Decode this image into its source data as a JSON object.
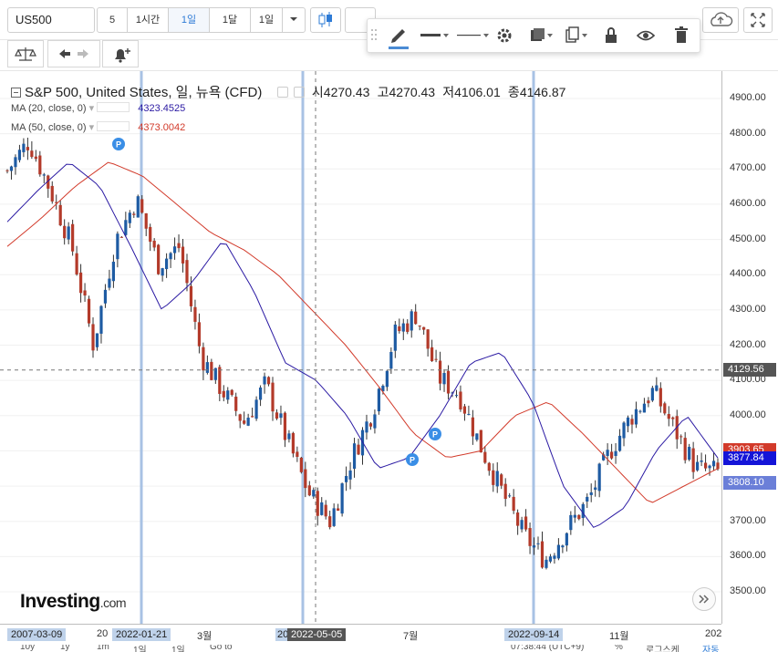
{
  "toolbar": {
    "symbol": "US500",
    "timeframes": [
      "5",
      "1시간",
      "1일",
      "1달",
      "1일"
    ],
    "active_timeframe": "1일"
  },
  "legend": {
    "title": "S&P 500, United States, 일, 뉴욕 (CFD)",
    "open_label": "시",
    "open": "4270.43",
    "high_label": "고",
    "high": "4270.43",
    "low_label": "저",
    "low": "4106.01",
    "close_label": "종",
    "close": "4146.87",
    "ma1_label": "MA (20, close, 0)",
    "ma1_value": "4323.4525",
    "ma1_color": "#2b1aa3",
    "ma2_label": "MA (50, close, 0)",
    "ma2_value": "4373.0042",
    "ma2_color": "#d23a2a"
  },
  "price_axis": {
    "ticks": [
      "4900.00",
      "4800.00",
      "4700.00",
      "4600.00",
      "4500.00",
      "4400.00",
      "4300.00",
      "4200.00",
      "4100.00",
      "4000.00",
      "3900.00",
      "3800.00",
      "3700.00",
      "3600.00",
      "3500.00"
    ],
    "crosshair_label": "4129.56",
    "label_ma50": "3903.65",
    "label_last": "3877.84",
    "label_ma20": "3808.10"
  },
  "time_axis": {
    "labels": [
      "2007-03-09",
      "20",
      "2022-01-21",
      "3월",
      "20",
      "2022-05-05",
      "7월",
      "2022-09-14",
      "11월",
      "202"
    ]
  },
  "bottom": {
    "items": [
      "10y",
      "1y",
      "1m",
      "1일",
      "Go to",
      "07:38:44 (UTC+9)",
      "%",
      "로그스케",
      "자동"
    ]
  },
  "watermark": {
    "brand": "Investing",
    "suffix": ".com"
  },
  "chart_data": {
    "type": "candlestick",
    "title": "S&P 500, United States, 일, 뉴욕 (CFD)",
    "ylim": [
      3450,
      4950
    ],
    "price_levels": [
      4900,
      4800,
      4700,
      4600,
      4500,
      4400,
      4300,
      4200,
      4100,
      4000,
      3900,
      3800,
      3700,
      3600,
      3500
    ],
    "ohlc_display": {
      "open": 4270.43,
      "high": 4270.43,
      "low": 4106.01,
      "close": 4146.87
    },
    "ma_20_value": 4323.4525,
    "ma_50_value": 4373.0042,
    "last_price": 3877.84,
    "crosshair_price": 4129.56,
    "ma_20_last": 3808.1,
    "ma_50_last": 3903.65,
    "key_closes": [
      4695,
      4780,
      4640,
      4480,
      4200,
      4490,
      4615,
      4430,
      4480,
      4170,
      4070,
      3980,
      4090,
      3930,
      3780,
      3700,
      3880,
      4020,
      4230,
      4290,
      4110,
      4060,
      3910,
      3780,
      3660,
      3590,
      3680,
      3760,
      3900,
      4000,
      4070,
      3960,
      3850,
      3840
    ],
    "ma20_path": [
      4550,
      4640,
      4720,
      4650,
      4480,
      4300,
      4380,
      4500,
      4350,
      4150,
      4100,
      4000,
      3850,
      3880,
      4000,
      4150,
      4180,
      4040,
      3800,
      3680,
      3740,
      3900,
      4000,
      3880
    ],
    "ma50_path": [
      4480,
      4560,
      4650,
      4720,
      4680,
      4600,
      4520,
      4470,
      4400,
      4300,
      4200,
      4080,
      3950,
      3880,
      3900,
      4000,
      4040,
      3950,
      3850,
      3750,
      3800,
      3850
    ],
    "series": [
      {
        "name": "MA (20, close, 0)",
        "color": "#2b1aa3"
      },
      {
        "name": "MA (50, close, 0)",
        "color": "#d23a2a"
      }
    ]
  }
}
